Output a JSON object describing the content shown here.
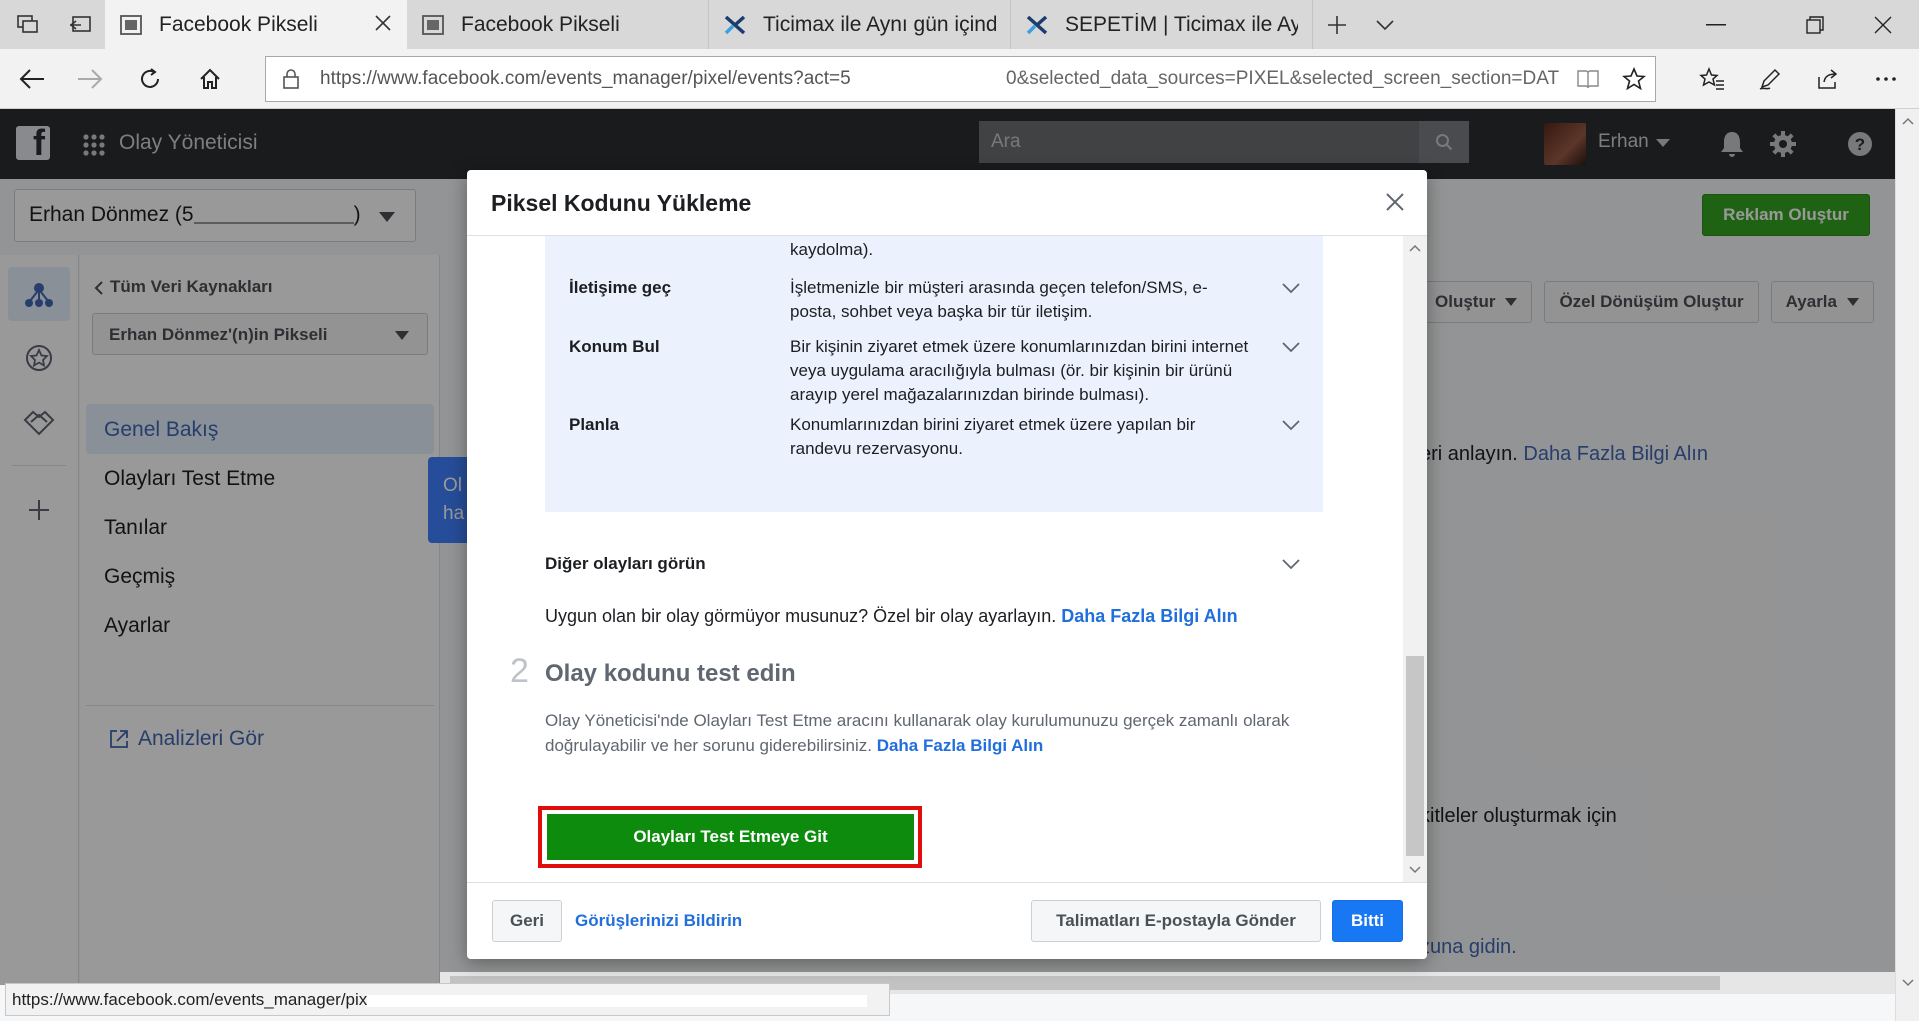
{
  "browser": {
    "tabs": [
      {
        "title": "Facebook Pikseli",
        "active": true
      },
      {
        "title": "Facebook Pikseli",
        "active": false
      },
      {
        "title": "Ticimax ile Aynı gün içinde e",
        "active": false
      },
      {
        "title": "SEPETİM | Ticimax ile Aynı g",
        "active": false
      }
    ],
    "url_host": "https://www.facebook.com",
    "url_path": "/events_manager/pixel/events?act=5",
    "url_tail": "0&selected_data_sources=PIXEL&selected_screen_section=DAT",
    "status_url": "https://www.facebook.com/events_manager/pix"
  },
  "header": {
    "app_title": "Olay Yöneticisi",
    "search_placeholder": "Ara",
    "user_name": "Erhan"
  },
  "account": {
    "name": "Erhan Dönmez (5",
    "name_end": ")",
    "create_ad": "Reklam Oluştur"
  },
  "sidebar": {
    "back": "Tüm Veri Kaynakları",
    "pixel": "Erhan Dönmez'(n)in Pikseli",
    "items": [
      "Genel Bakış",
      "Olayları Test Etme",
      "Tanılar",
      "Geçmiş",
      "Ayarlar"
    ],
    "analytics_link": "Analizleri Gör"
  },
  "tooltip": {
    "line1": "Ol",
    "line2": "ha"
  },
  "main": {
    "toolbar": [
      "Oluştur",
      "Özel Dönüşüm Oluştur",
      "Ayarla"
    ],
    "line1": "eri anlayın.",
    "line1_link": "Daha Fazla Bilgi Alın",
    "line2": "kitleler oluşturmak için",
    "line3_link": "zuna gidin."
  },
  "modal": {
    "title": "Piksel Kodunu Yükleme",
    "partial_text": "kaydolma).",
    "events": [
      {
        "name": "İletişime geç",
        "desc": "İşletmenizle bir müşteri arasında geçen telefon/SMS, e-posta, sohbet veya başka bir tür iletişim."
      },
      {
        "name": "Konum Bul",
        "desc": "Bir kişinin ziyaret etmek üzere konumlarınızdan birini internet veya uygulama aracılığıyla bulması (ör. bir kişinin bir ürünü arayıp yerel mağazalarınızdan birinde bulması)."
      },
      {
        "name": "Planla",
        "desc": "Konumlarınızdan birini ziyaret etmek üzere yapılan bir randevu rezervasyonu."
      }
    ],
    "other_events": "Diğer olayları görün",
    "custom_prompt": "Uygun olan bir olay görmüyor musunuz? Özel bir olay ayarlayın.",
    "custom_link": "Daha Fazla Bilgi Alın",
    "step_number": "2",
    "step_title": "Olay kodunu test edin",
    "step_desc": "Olay Yöneticisi'nde Olayları Test Etme aracını kullanarak olay kurulumunuzu gerçek zamanlı olarak doğrulayabilir ve her sorunu giderebilirsiniz.",
    "step_link": "Daha Fazla Bilgi Alın",
    "go_button": "Olayları Test Etmeye Git",
    "footer": {
      "back": "Geri",
      "feedback": "Görüşlerinizi Bildirin",
      "email": "Talimatları E-postayla Gönder",
      "done": "Bitti"
    }
  },
  "colors": {
    "fb_header": "#2b2d31",
    "green": "#0d8b0d",
    "blue_button": "#1877f2",
    "link": "#216fdb",
    "highlight_box": "#e00d0d"
  }
}
